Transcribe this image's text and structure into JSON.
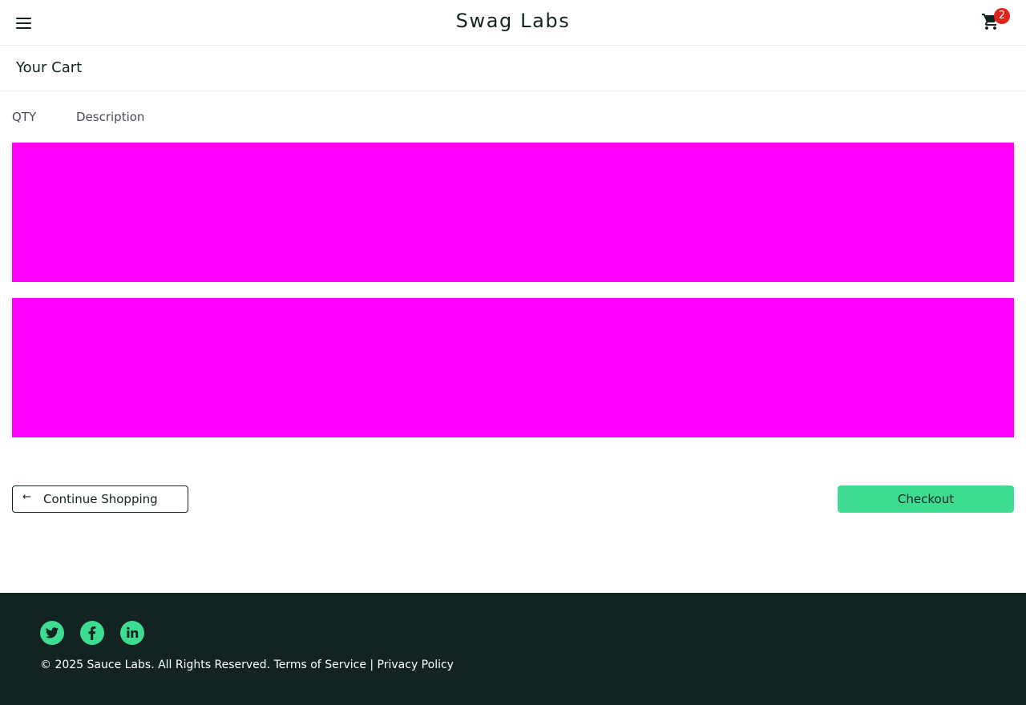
{
  "header": {
    "app_title": "Swag Labs",
    "cart_count": "2",
    "menu_icon": "hamburger-menu-icon",
    "cart_icon": "shopping-cart-icon"
  },
  "page": {
    "title": "Your Cart"
  },
  "cart_list": {
    "qty_label": "QTY",
    "description_label": "Description"
  },
  "actions": {
    "continue_label": "Continue Shopping",
    "checkout_label": "Checkout"
  },
  "footer": {
    "social": [
      "twitter-icon",
      "facebook-icon",
      "linkedin-icon"
    ],
    "copyright": "© 2025 Sauce Labs. All Rights Reserved. Terms of Service | Privacy Policy"
  },
  "colors": {
    "accent": "#3ddc91",
    "badge": "#e2231a",
    "footer_bg": "#132322",
    "placeholder_item": "#ff00ff"
  }
}
